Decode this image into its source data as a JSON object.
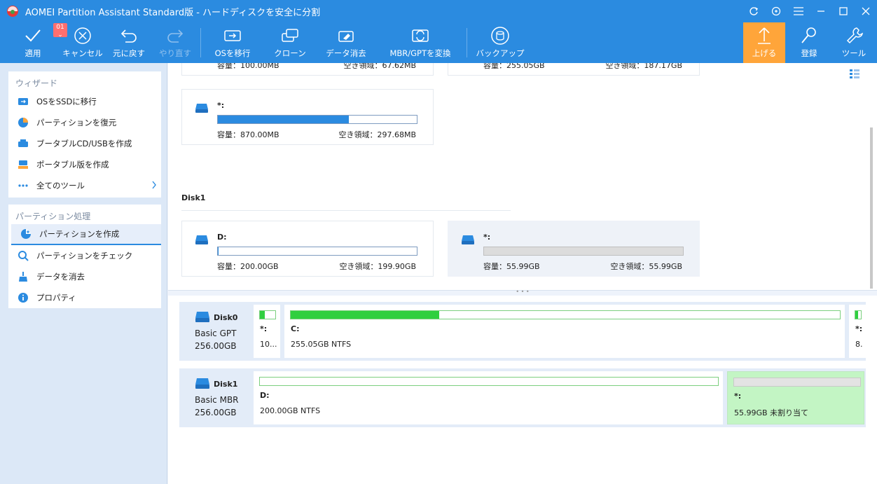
{
  "window": {
    "title": "AOMEI Partition Assistant Standard版 - ハードディスクを安全に分割"
  },
  "toolbar": {
    "apply": {
      "label": "適用",
      "badge": "01"
    },
    "cancel": {
      "label": "キャンセル"
    },
    "undo": {
      "label": "元に戻す"
    },
    "redo": {
      "label": "やり直す"
    },
    "migrate_os": {
      "label": "OSを移行"
    },
    "clone": {
      "label": "クローン"
    },
    "wipe": {
      "label": "データ消去"
    },
    "convert": {
      "label": "MBR/GPTを変換"
    },
    "backup": {
      "label": "バックアップ"
    },
    "upgrade": {
      "label": "上げる"
    },
    "register": {
      "label": "登録"
    },
    "tools": {
      "label": "ツール"
    }
  },
  "sidebar": {
    "wizard": {
      "heading": "ウィザード",
      "items": [
        {
          "label": "OSをSSDに移行",
          "icon": "migrate-icon"
        },
        {
          "label": "パーティションを復元",
          "icon": "restore-icon"
        },
        {
          "label": "ブータブルCD/USBを作成",
          "icon": "bootable-icon"
        },
        {
          "label": "ポータブル版を作成",
          "icon": "portable-icon"
        },
        {
          "label": "全てのツール",
          "icon": "dots-icon"
        }
      ]
    },
    "partition_ops": {
      "heading": "パーティション処理",
      "items": [
        {
          "label": "パーティションを作成",
          "icon": "create-partition-icon"
        },
        {
          "label": "パーティションをチェック",
          "icon": "check-icon"
        },
        {
          "label": "データを消去",
          "icon": "wipe-icon"
        },
        {
          "label": "プロパティ",
          "icon": "info-icon"
        }
      ]
    }
  },
  "cards": {
    "top_left": {
      "cap": "容量：100.00MB",
      "free": "空き領域：67.62MB"
    },
    "top_right": {
      "cap": "容量：255.05GB",
      "free": "空き領域：187.17GB"
    },
    "star": {
      "name": "*:",
      "cap": "容量：870.00MB",
      "free": "空き領域：297.68MB",
      "used_fraction": 0.658
    },
    "disk1_heading": "Disk1",
    "d": {
      "name": "D:",
      "cap": "容量：200.00GB",
      "free": "空き領域：199.90GB",
      "used_fraction": 0.0005
    },
    "unalloc": {
      "name": "*:",
      "cap": "容量：55.99GB",
      "free": "空き領域：55.99GB"
    }
  },
  "diskmap": {
    "disk0": {
      "name": "Disk0",
      "type": "Basic GPT",
      "size": "256.00GB",
      "parts": [
        {
          "name": "*:",
          "info": "10...",
          "used_fraction": 0.32
        },
        {
          "name": "C:",
          "info": "255.05GB NTFS",
          "used_fraction": 0.27
        },
        {
          "name": "*:",
          "info": "8.",
          "used_fraction": 0.5
        }
      ]
    },
    "disk1": {
      "name": "Disk1",
      "type": "Basic MBR",
      "size": "256.00GB",
      "parts": [
        {
          "name": "D:",
          "info": "200.00GB NTFS",
          "used_fraction": 0.0
        },
        {
          "name": "*:",
          "info": "55.99GB 未割り当て",
          "used_fraction": 0.0
        }
      ]
    }
  },
  "colors": {
    "accent": "#2b8be0",
    "highlight": "#ffa53a",
    "used_green": "#2fcf3f",
    "unallocated_bg": "#c3f5c4"
  }
}
